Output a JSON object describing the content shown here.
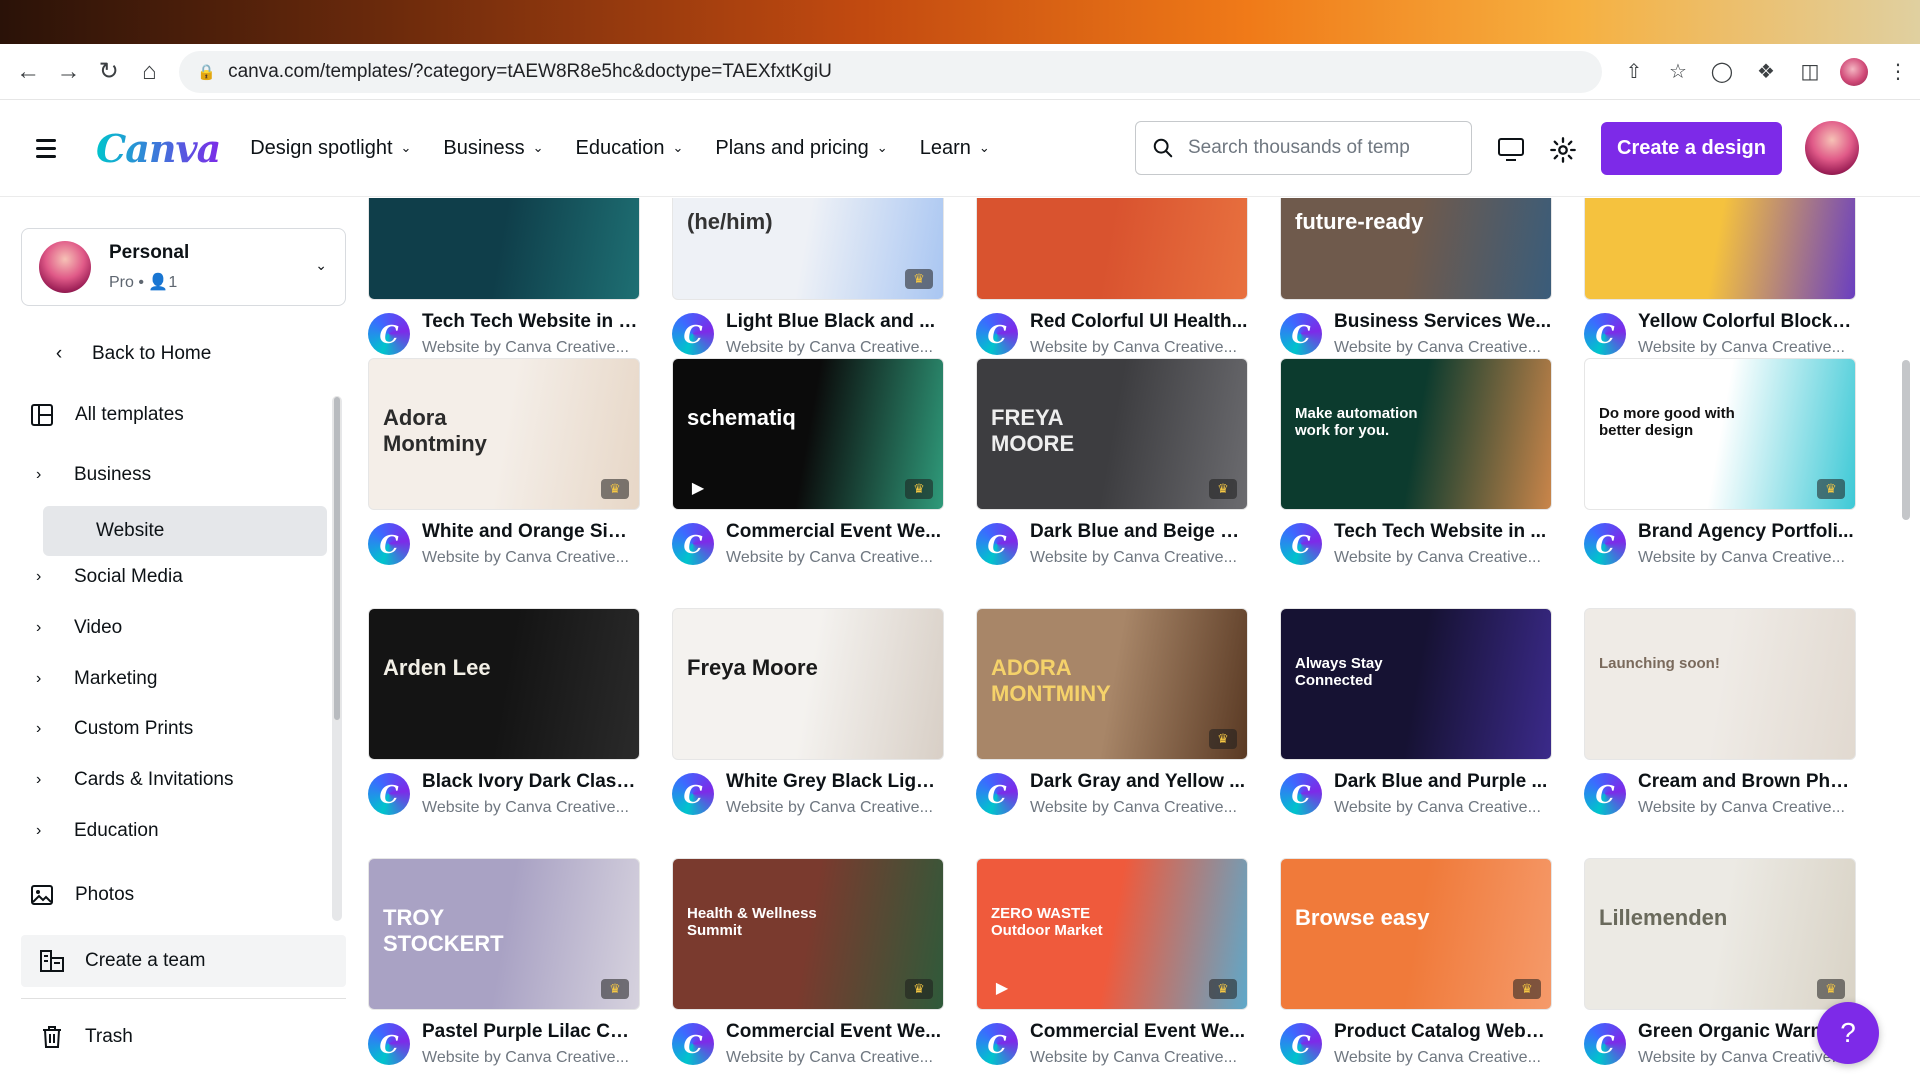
{
  "browser": {
    "url": "canva.com/templates/?category=tAEW8R8e5hc&doctype=TAEXfxtKgiU"
  },
  "header": {
    "logo": "Canva",
    "nav": [
      "Design spotlight",
      "Business",
      "Education",
      "Plans and pricing",
      "Learn"
    ],
    "search_placeholder": "Search thousands of temp",
    "create_button": "Create a design"
  },
  "sidebar": {
    "team_name": "Personal",
    "team_sub": "Pro • 👤1",
    "back": "Back to Home",
    "all_templates": "All templates",
    "categories": [
      "Business",
      "Website",
      "Social Media",
      "Video",
      "Marketing",
      "Custom Prints",
      "Cards & Invitations",
      "Education"
    ],
    "photos": "Photos",
    "create_team": "Create a team",
    "trash": "Trash"
  },
  "cards": [
    {
      "title": "Tech Tech Website in T...",
      "sub": "Website by Canva Creative...",
      "thumb": "#0f3e4a",
      "thumb2": "#1e6f73",
      "text": "",
      "textColor": "#ffffff",
      "crown": false,
      "play": false
    },
    {
      "title": "Light Blue Black and ...",
      "sub": "Website by Canva Creative...",
      "thumb": "#eef1f6",
      "thumb2": "#a9c6f2",
      "text": "(he/him)",
      "textColor": "#333333",
      "crown": true,
      "play": false
    },
    {
      "title": "Red Colorful UI Health...",
      "sub": "Website by Canva Creative...",
      "thumb": "#d9532f",
      "thumb2": "#e8713f",
      "text": "",
      "textColor": "#ffffff",
      "crown": false,
      "play": false
    },
    {
      "title": "Business Services We...",
      "sub": "Website by Canva Creative...",
      "thumb": "#6f5a4c",
      "thumb2": "#3a5c7a",
      "text": "future-ready",
      "textColor": "#ffffff",
      "crown": false,
      "play": false
    },
    {
      "title": "Yellow Colorful Blocks...",
      "sub": "Website by Canva Creative...",
      "thumb": "#f5c23e",
      "thumb2": "#6a3fc0",
      "text": "",
      "textColor": "#ffffff",
      "crown": false,
      "play": false
    },
    {
      "title": "White and Orange Sim...",
      "sub": "Website by Canva Creative...",
      "thumb": "#f4eee8",
      "thumb2": "#e7d7c7",
      "text": "Adora Montminy",
      "textColor": "#2b2b2b",
      "crown": true,
      "play": false
    },
    {
      "title": "Commercial Event We...",
      "sub": "Website by Canva Creative...",
      "thumb": "#0b0b0b",
      "thumb2": "#2f9a7a",
      "text": "schematiq",
      "textColor": "#ffffff",
      "crown": true,
      "play": true
    },
    {
      "title": "Dark Blue and Beige Si...",
      "sub": "Website by Canva Creative...",
      "thumb": "#3d3d40",
      "thumb2": "#6b6b6f",
      "text": "FREYA MOORE",
      "textColor": "#eeeeee",
      "crown": true,
      "play": false
    },
    {
      "title": "Tech Tech Website in ...",
      "sub": "Website by Canva Creative...",
      "thumb": "#0c3b2e",
      "thumb2": "#c9854a",
      "text": "Make automation work for you.",
      "textColor": "#ffffff",
      "crown": false,
      "play": false
    },
    {
      "title": "Brand Agency Portfoli...",
      "sub": "Website by Canva Creative...",
      "thumb": "#ffffff",
      "thumb2": "#3ec9d6",
      "text": "Do more good with better design",
      "textColor": "#111111",
      "crown": true,
      "play": true
    },
    {
      "title": "Black Ivory Dark Class...",
      "sub": "Website by Canva Creative...",
      "thumb": "#141414",
      "thumb2": "#2a2a2a",
      "text": "Arden Lee",
      "textColor": "#f2efe6",
      "crown": false,
      "play": false
    },
    {
      "title": "White Grey Black Light...",
      "sub": "Website by Canva Creative...",
      "thumb": "#f4f2ef",
      "thumb2": "#d8cfc6",
      "text": "Freya Moore",
      "textColor": "#1a1a1a",
      "crown": false,
      "play": false
    },
    {
      "title": "Dark Gray and Yellow ...",
      "sub": "Website by Canva Creative...",
      "thumb": "#a88668",
      "thumb2": "#5a3a24",
      "text": "ADORA MONTMINY",
      "textColor": "#f5d26a",
      "crown": true,
      "play": false
    },
    {
      "title": "Dark Blue and Purple ...",
      "sub": "Website by Canva Creative...",
      "thumb": "#161233",
      "thumb2": "#3b2a8a",
      "text": "Always Stay Connected",
      "textColor": "#ffffff",
      "crown": false,
      "play": false
    },
    {
      "title": "Cream and Brown Pho...",
      "sub": "Website by Canva Creative...",
      "thumb": "#efebe6",
      "thumb2": "#e1d9d0",
      "text": "Launching soon!",
      "textColor": "#7a6a5c",
      "crown": false,
      "play": false
    },
    {
      "title": "Pastel Purple Lilac Col...",
      "sub": "Website by Canva Creative...",
      "thumb": "#a9a2c4",
      "thumb2": "#d6d2de",
      "text": "TROY STOCKERT",
      "textColor": "#ffffff",
      "crown": true,
      "play": false
    },
    {
      "title": "Commercial Event We...",
      "sub": "Website by Canva Creative...",
      "thumb": "#7a3a2e",
      "thumb2": "#2f5a3a",
      "text": "Health & Wellness Summit",
      "textColor": "#ffffff",
      "crown": true,
      "play": false
    },
    {
      "title": "Commercial Event We...",
      "sub": "Website by Canva Creative...",
      "thumb": "#ef5a3c",
      "thumb2": "#5fa8c9",
      "text": "ZERO WASTE Outdoor Market",
      "textColor": "#ffffff",
      "crown": true,
      "play": true
    },
    {
      "title": "Product Catalog Webs...",
      "sub": "Website by Canva Creative...",
      "thumb": "#f07a3a",
      "thumb2": "#f59a6a",
      "text": "Browse easy",
      "textColor": "#ffffff",
      "crown": true,
      "play": false
    },
    {
      "title": "Green Organic Warm...",
      "sub": "Website by Canva Creative...",
      "thumb": "#eceae4",
      "thumb2": "#d9d3c6",
      "text": "Lillemenden",
      "textColor": "#6a6a5c",
      "crown": true,
      "play": false
    }
  ],
  "help_label": "?"
}
